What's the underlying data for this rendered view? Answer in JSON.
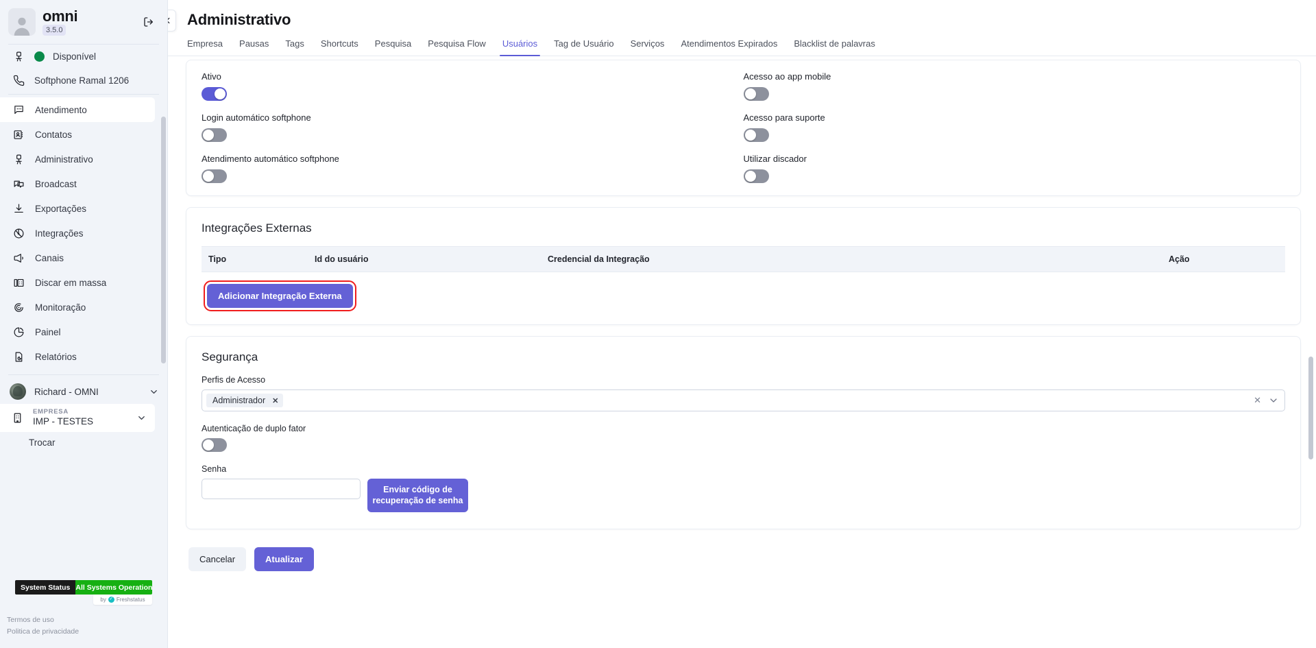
{
  "sidebar": {
    "brand": {
      "name": "omni",
      "version": "3.5.0"
    },
    "logout_icon": "logout-icon",
    "status": {
      "label": "Disponível",
      "icon": "agent-chair-icon"
    },
    "softphone": {
      "label": "Softphone Ramal 1206",
      "icon": "phone-icon"
    },
    "nav": [
      {
        "label": "Atendimento",
        "icon": "chat-bubble-icon",
        "active": true
      },
      {
        "label": "Contatos",
        "icon": "contact-card-icon",
        "active": false
      },
      {
        "label": "Administrativo",
        "icon": "agent-chair-icon",
        "active": false
      },
      {
        "label": "Broadcast",
        "icon": "broadcast-bubbles-icon",
        "active": false
      },
      {
        "label": "Exportações",
        "icon": "download-icon",
        "active": false
      },
      {
        "label": "Integrações",
        "icon": "integrations-globe-icon",
        "active": false
      },
      {
        "label": "Canais",
        "icon": "megaphone-icon",
        "active": false
      },
      {
        "label": "Discar em massa",
        "icon": "deskphone-icon",
        "active": false
      },
      {
        "label": "Monitoração",
        "icon": "target-icon",
        "active": false
      },
      {
        "label": "Painel",
        "icon": "pie-chart-icon",
        "active": false
      },
      {
        "label": "Relatórios",
        "icon": "report-doc-icon",
        "active": false
      }
    ],
    "user": {
      "name": "Richard - OMNI"
    },
    "company": {
      "label": "EMPRESA",
      "name": "IMP - TESTES"
    },
    "switch_label": "Trocar",
    "system_status": {
      "left": "System Status",
      "right": "All Systems Operational",
      "by": "by",
      "provider": "Freshstatus"
    },
    "legal": {
      "terms": "Termos de uso",
      "privacy": "Politica de privacidade"
    }
  },
  "header": {
    "title": "Administrativo",
    "collapse_icon": "chevron-left-icon",
    "tabs": [
      {
        "label": "Empresa",
        "active": false
      },
      {
        "label": "Pausas",
        "active": false
      },
      {
        "label": "Tags",
        "active": false
      },
      {
        "label": "Shortcuts",
        "active": false
      },
      {
        "label": "Pesquisa",
        "active": false
      },
      {
        "label": "Pesquisa Flow",
        "active": false
      },
      {
        "label": "Usuários",
        "active": true
      },
      {
        "label": "Tag de Usuário",
        "active": false
      },
      {
        "label": "Serviços",
        "active": false
      },
      {
        "label": "Atendimentos Expirados",
        "active": false
      },
      {
        "label": "Blacklist de palavras",
        "active": false
      }
    ]
  },
  "settings_card": {
    "left": [
      {
        "label": "Ativo",
        "state": "on"
      },
      {
        "label": "Login automático softphone",
        "state": "off"
      },
      {
        "label": "Atendimento automático softphone",
        "state": "off"
      }
    ],
    "right": [
      {
        "label": "Acesso ao app mobile",
        "state": "off"
      },
      {
        "label": "Acesso para suporte",
        "state": "off"
      },
      {
        "label": "Utilizar discador",
        "state": "off"
      }
    ]
  },
  "integrations": {
    "heading": "Integrações Externas",
    "columns": [
      "Tipo",
      "Id do usuário",
      "Credencial da Integração",
      "Ação"
    ],
    "rows": [],
    "add_button": "Adicionar Integração Externa",
    "highlight_color": "#f01d1d"
  },
  "security": {
    "heading": "Segurança",
    "profiles_label": "Perfis de Acesso",
    "profiles_selected": [
      "Administrador"
    ],
    "chip_remove_icon": "close-icon",
    "clear_icon": "clear-icon",
    "caret_icon": "chevron-down-icon",
    "twofactor_label": "Autenticação de duplo fator",
    "twofactor_state": "off",
    "password_label": "Senha",
    "password_value": "",
    "password_placeholder": "",
    "send_code_button": "Enviar código de recuperação de senha"
  },
  "footer": {
    "cancel": "Cancelar",
    "update": "Atualizar"
  },
  "theme": {
    "accent": "#5b5bd6",
    "primary_button": "#6461d6",
    "green": "#0a8a4a",
    "status_green": "#16b012"
  }
}
